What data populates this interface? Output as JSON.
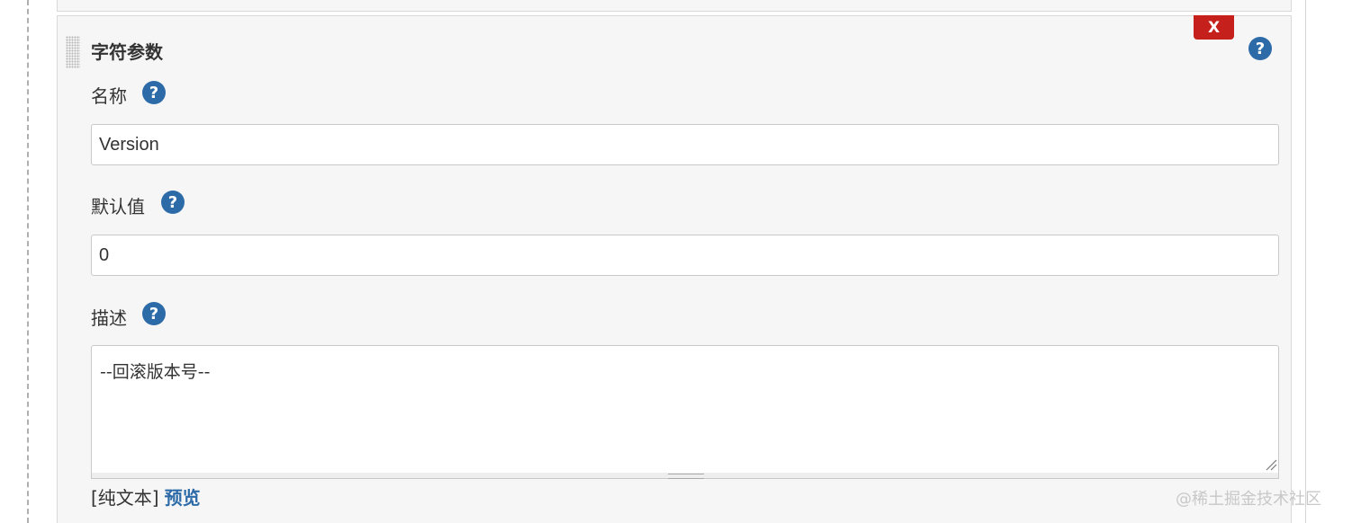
{
  "parameter": {
    "title": "字符参数",
    "delete_label": "X",
    "help_glyph": "?",
    "fields": {
      "name": {
        "label": "名称",
        "value": "Version"
      },
      "default_value": {
        "label": "默认值",
        "value": "0"
      },
      "description": {
        "label": "描述",
        "value": "--回滚版本号--"
      }
    },
    "format": {
      "plain_text": "[纯文本]",
      "preview": "预览"
    }
  },
  "watermark": "@稀土掘金技术社区",
  "colors": {
    "delete_button": "#c5201b",
    "help_icon": "#2d6ba8",
    "link": "#2d6ba8",
    "panel_background": "#f6f6f6"
  },
  "icons": {
    "help": "help-icon",
    "drag": "drag-handle-icon",
    "resize": "resize-grip-icon"
  }
}
